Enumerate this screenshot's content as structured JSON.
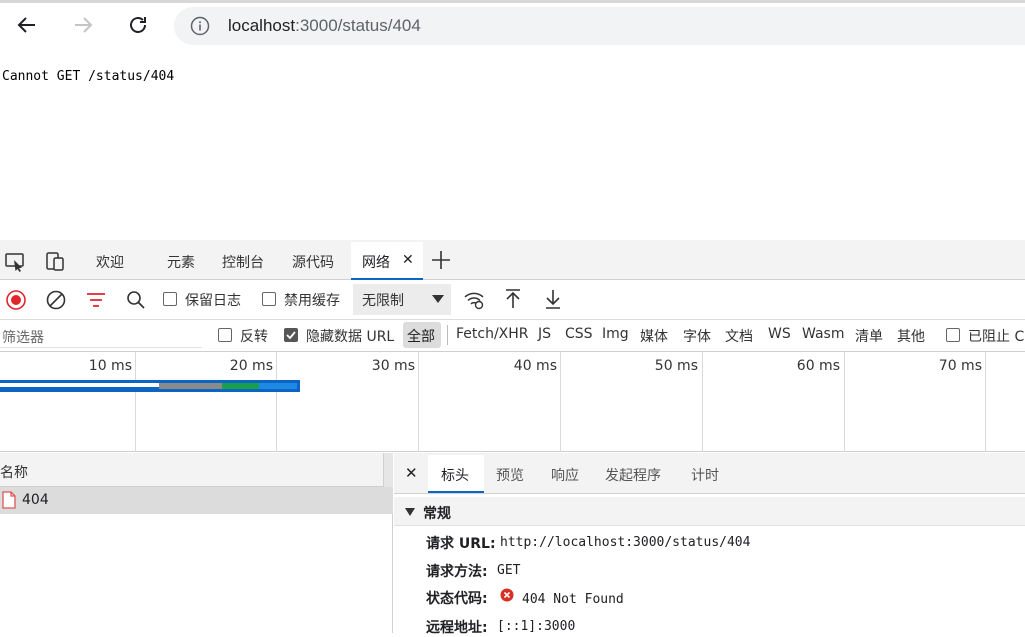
{
  "browser": {
    "url_host": "localhost",
    "url_path": ":3000/status/404"
  },
  "page": {
    "message": "Cannot GET /status/404"
  },
  "devtools": {
    "tabs": [
      "欢迎",
      "元素",
      "控制台",
      "源代码",
      "网络"
    ],
    "toolbar": {
      "preserve_log": "保留日志",
      "disable_cache": "禁用缓存",
      "throttle": "无限制"
    },
    "filter": {
      "placeholder": "筛选器",
      "invert": "反转",
      "hide_data_urls": "隐藏数据 URL",
      "types": [
        "全部",
        "Fetch/XHR",
        "JS",
        "CSS",
        "Img",
        "媒体",
        "字体",
        "文档",
        "WS",
        "Wasm",
        "清单",
        "其他"
      ],
      "blocked": "已阻止 C"
    },
    "timeline_ticks": [
      "10 ms",
      "20 ms",
      "30 ms",
      "40 ms",
      "50 ms",
      "60 ms",
      "70 ms"
    ],
    "request_list": {
      "header": "名称",
      "rows": [
        {
          "name": "404"
        }
      ]
    },
    "detail": {
      "tabs": [
        "标头",
        "预览",
        "响应",
        "发起程序",
        "计时"
      ],
      "section": "常规",
      "rows": [
        {
          "key": "请求 URL:",
          "value": "http://localhost:3000/status/404"
        },
        {
          "key": "请求方法:",
          "value": "GET"
        },
        {
          "key": "状态代码:",
          "value": "404 Not Found"
        },
        {
          "key": "远程地址:",
          "value": "[::1]:3000"
        }
      ]
    }
  },
  "colors": {
    "accent": "#0a66c2",
    "record": "#e0262d",
    "error": "#d93025",
    "error_file": "#e05555"
  }
}
